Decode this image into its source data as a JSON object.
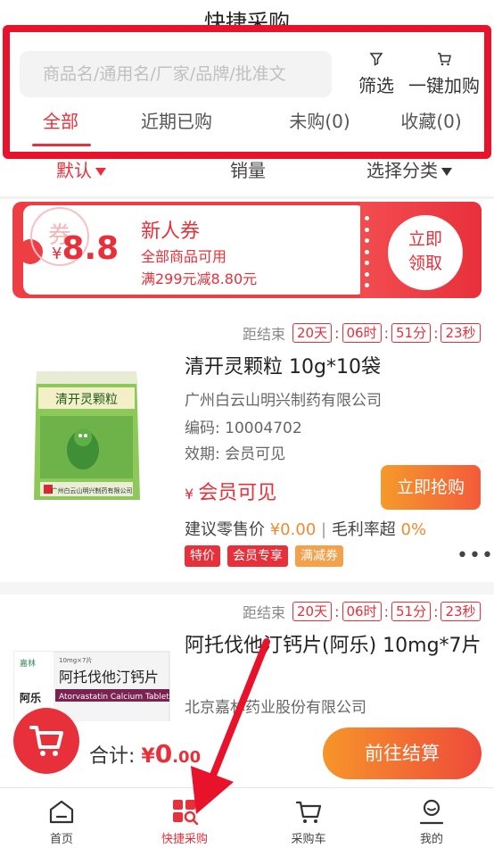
{
  "header": {
    "title": "快捷采购",
    "search_placeholder": "商品名/通用名/厂家/品牌/批准文",
    "filter_label": "筛选",
    "add_all_label": "一键加购"
  },
  "tabs": [
    {
      "label": "全部",
      "active": true
    },
    {
      "label": "近期已购",
      "active": false
    },
    {
      "label": "未购(0)",
      "active": false
    },
    {
      "label": "收藏(0)",
      "active": false
    }
  ],
  "sort": {
    "default_label": "默认",
    "sales_label": "销量",
    "category_label": "选择分类"
  },
  "coupon": {
    "stamp": "券",
    "currency": "¥",
    "amount": "8.8",
    "title": "新人券",
    "scope": "全部商品可用",
    "rule": "满299元减8.80元",
    "claim_line1": "立即",
    "claim_line2": "领取"
  },
  "products": [
    {
      "countdown_label": "距结束",
      "days": "20天",
      "hours": "06时",
      "minutes": "51分",
      "seconds": "23秒",
      "name": "清开灵颗粒 10g*10袋",
      "manufacturer": "广州白云山明兴制药有限公司",
      "code": "编码: 10004702",
      "expiry": "效期: 会员可见",
      "price_currency": "¥",
      "price_text": "会员可见",
      "grab_label": "立即抢购",
      "retail_label": "建议零售价",
      "retail_value": "¥0.00",
      "margin_label": "毛利率超",
      "margin_value": "0%",
      "tags": [
        "特价",
        "会员专享",
        "满减券"
      ],
      "more": "•••",
      "image_text_main": "清开灵颗粒",
      "image_text_brand": "广州白云山明兴制药有限公司"
    },
    {
      "countdown_label": "距结束",
      "days": "20天",
      "hours": "06时",
      "minutes": "51分",
      "seconds": "23秒",
      "name": "阿托伐他汀钙片(阿乐) 10mg*7片",
      "manufacturer": "北京嘉林药业股份有限公司",
      "image_text_main": "阿托伐他汀钙片",
      "image_text_en": "Atorvastatin Calcium Tablets",
      "image_text_brand": "阿乐",
      "image_text_maker": "嘉林",
      "image_text_spec": "10mg×7片"
    }
  ],
  "cart": {
    "total_label": "合计:",
    "currency": "¥",
    "amount_int": "0",
    "amount_dec": ".00",
    "checkout_label": "前往结算"
  },
  "nav": [
    {
      "label": "首页",
      "icon": "home-icon",
      "active": false
    },
    {
      "label": "快捷采购",
      "icon": "quick-purchase-icon",
      "active": true
    },
    {
      "label": "采购车",
      "icon": "cart-icon",
      "active": false
    },
    {
      "label": "我的",
      "icon": "profile-icon",
      "active": false
    }
  ],
  "colors": {
    "accent": "#e8303a",
    "orange": "#f59a2b",
    "highlight_box": "#e8132a"
  }
}
